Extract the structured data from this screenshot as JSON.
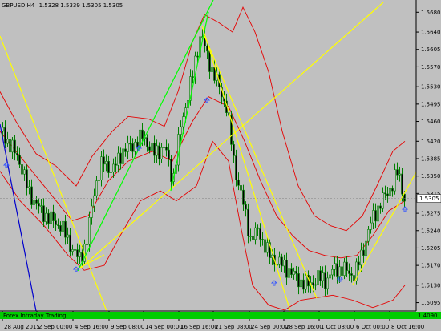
{
  "window": {
    "title": "GBPUSD,H4",
    "ohlc": "1.5328 1.5339 1.5305 1.5305"
  },
  "colors": {
    "background": "#c0c0c0",
    "candle": "#008000",
    "bollinger": "#e60000",
    "trendline_yellow": "#ffff00",
    "trendline_green": "#00ff00",
    "trendline_blue": "#0000cc",
    "arrow": "#3355ff",
    "current_price_bg": "#ffffff",
    "indicator_bar": "#00cc00"
  },
  "chart_data": {
    "type": "candlestick",
    "symbol": "GBPUSD",
    "timeframe": "H4",
    "y_ticks": [
      "1.5680",
      "1.5640",
      "1.5605",
      "1.5570",
      "1.5530",
      "1.5495",
      "1.5460",
      "1.5420",
      "1.5385",
      "1.5350",
      "1.5315",
      "1.5275",
      "1.5240",
      "1.5205",
      "1.5170",
      "1.5130",
      "1.5095"
    ],
    "ylim": [
      1.5083,
      1.5695
    ],
    "x_ticks": [
      "28 Aug 2015",
      "2 Sep 00:00",
      "4 Sep 16:00",
      "9 Sep 08:00",
      "14 Sep 00:00",
      "16 Sep 16:00",
      "21 Sep 08:00",
      "24 Sep 00:00",
      "28 Sep 16:00",
      "1 Oct 08:00",
      "6 Oct 00:00",
      "8 Oct 16:00"
    ],
    "current_price": "1.5305",
    "last_close": 1.5305
  },
  "indicator": {
    "label": "Forex Intraday Trading",
    "value": "1.4090"
  }
}
